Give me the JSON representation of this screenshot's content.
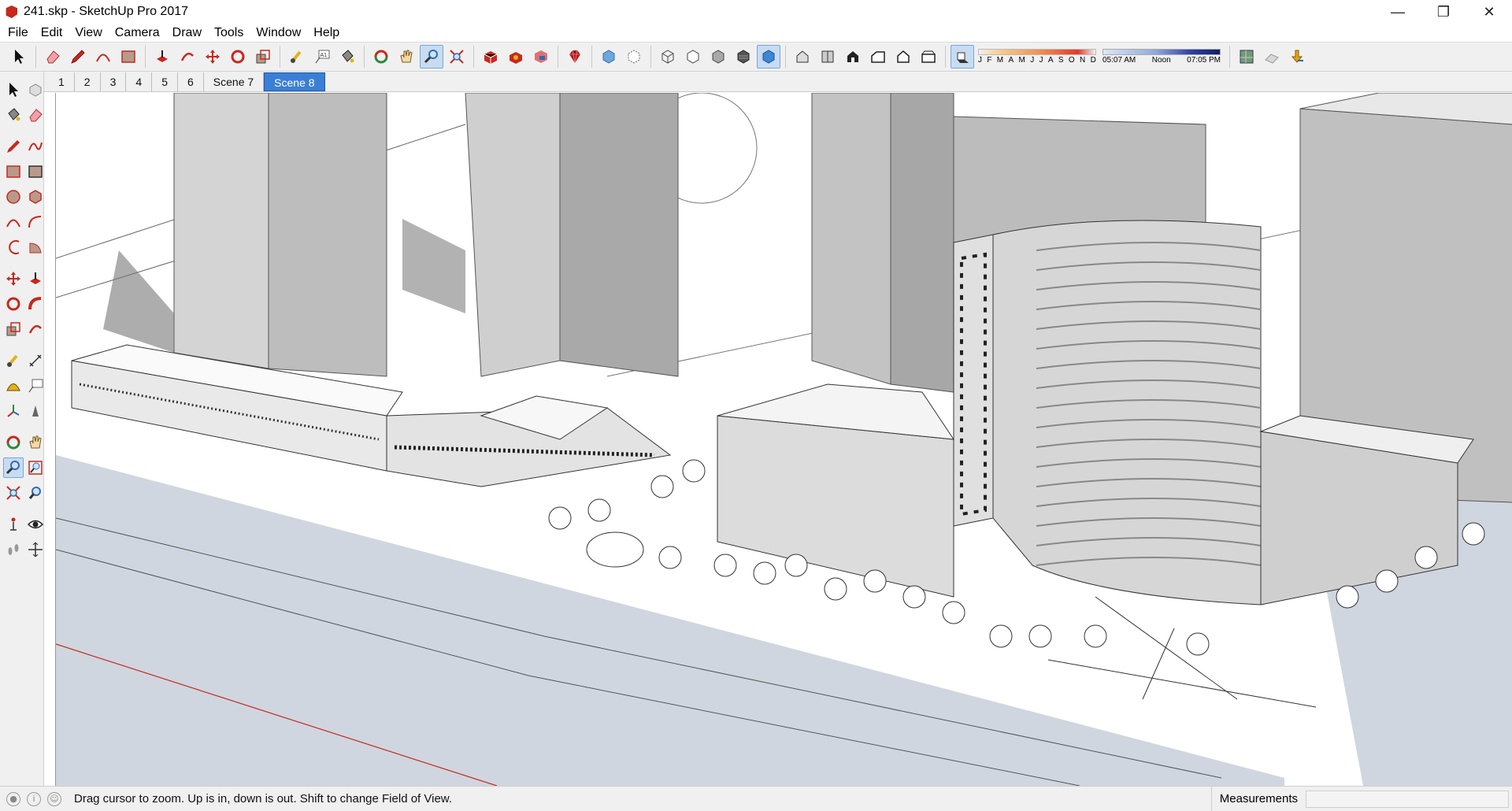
{
  "window": {
    "title": "241.skp - SketchUp Pro 2017",
    "minimize_glyph": "—",
    "restore_glyph": "❐",
    "close_glyph": "✕"
  },
  "menu": [
    "File",
    "Edit",
    "View",
    "Camera",
    "Draw",
    "Tools",
    "Window",
    "Help"
  ],
  "shadow_settings": {
    "months": [
      "J",
      "F",
      "M",
      "A",
      "M",
      "J",
      "J",
      "A",
      "S",
      "O",
      "N",
      "D"
    ],
    "sunrise": "05:07 AM",
    "noon": "Noon",
    "sunset": "07:05 PM"
  },
  "scenes": [
    {
      "label": "1",
      "active": false
    },
    {
      "label": "2",
      "active": false
    },
    {
      "label": "3",
      "active": false
    },
    {
      "label": "4",
      "active": false
    },
    {
      "label": "5",
      "active": false
    },
    {
      "label": "6",
      "active": false
    },
    {
      "label": "Scene 7",
      "active": false
    },
    {
      "label": "Scene 8",
      "active": true
    }
  ],
  "status": {
    "message": "Drag cursor to zoom.  Up is in, down is out. Shift to change Field of View.",
    "measurements_label": "Measurements",
    "measurements_value": ""
  },
  "active_tool": "zoom",
  "colors": {
    "accent": "#3a7fd6",
    "icon_red": "#c8281e",
    "icon_blue": "#2e6db5"
  }
}
